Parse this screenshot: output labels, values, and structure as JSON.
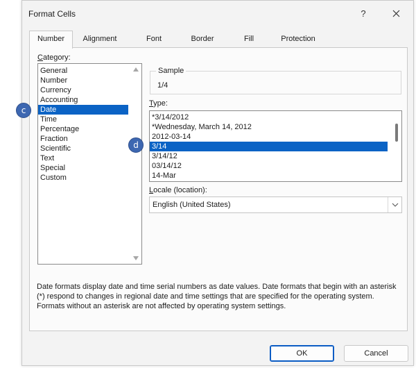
{
  "window": {
    "title": "Format Cells",
    "help_label": "?",
    "close_icon": "close-icon"
  },
  "tabs": [
    {
      "label": "Number",
      "active": true
    },
    {
      "label": "Alignment",
      "active": false
    },
    {
      "label": "Font",
      "active": false
    },
    {
      "label": "Border",
      "active": false
    },
    {
      "label": "Fill",
      "active": false
    },
    {
      "label": "Protection",
      "active": false
    }
  ],
  "category": {
    "label_accel": "C",
    "label_rest": "ategory:",
    "items": [
      "General",
      "Number",
      "Currency",
      "Accounting",
      "Date",
      "Time",
      "Percentage",
      "Fraction",
      "Scientific",
      "Text",
      "Special",
      "Custom"
    ],
    "selected": "Date"
  },
  "sample": {
    "label": "Sample",
    "value": "1/4"
  },
  "type": {
    "label_accel": "T",
    "label_rest": "ype:",
    "items": [
      "*3/14/2012",
      "*Wednesday, March 14, 2012",
      "2012-03-14",
      "3/14",
      "3/14/12",
      "03/14/12",
      "14-Mar"
    ],
    "selected": "3/14"
  },
  "locale": {
    "label_accel": "L",
    "label_rest": "ocale (location):",
    "value": "English (United States)"
  },
  "description": {
    "line1": "Date formats display date and time serial numbers as date values.  Date formats that begin with an asterisk",
    "line2": "(*) respond to changes in regional date and time settings that are specified for the operating system.",
    "line3": "Formats without an asterisk are not affected by operating system settings."
  },
  "buttons": {
    "ok": "OK",
    "cancel": "Cancel"
  },
  "markers": {
    "c": "c",
    "d": "d"
  },
  "colors": {
    "selection": "#0b63c5",
    "marker": "#3d67b1"
  }
}
